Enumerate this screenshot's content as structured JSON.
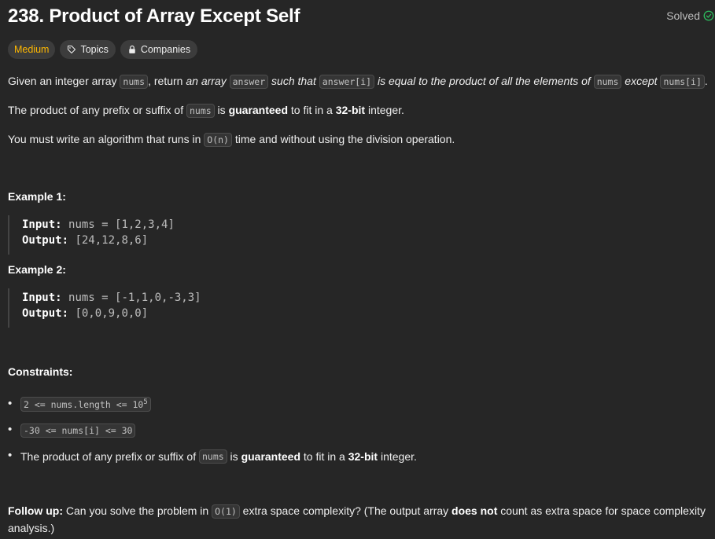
{
  "title": "238. Product of Array Except Self",
  "status": "Solved",
  "pills": {
    "difficulty": "Medium",
    "topics": "Topics",
    "companies": "Companies"
  },
  "desc": {
    "p1": {
      "t1": "Given an integer array ",
      "c1": "nums",
      "t2": ", return ",
      "e1": "an array",
      "c2": "answer",
      "e2": "such that",
      "c3": "answer[i]",
      "e3": "is equal to the product of all the elements of",
      "c4": "nums",
      "e4": "except",
      "c5": "nums[i]",
      "t3": "."
    },
    "p2": {
      "t1": "The product of any prefix or suffix of ",
      "c1": "nums",
      "t2": " is ",
      "b1": "guaranteed",
      "t3": " to fit in a ",
      "b2": "32-bit",
      "t4": " integer."
    },
    "p3": {
      "t1": "You must write an algorithm that runs in ",
      "c1": "O(n)",
      "t2": " time and without using the division operation."
    }
  },
  "examples": [
    {
      "title": "Example 1:",
      "input_label": "Input:",
      "input": "nums = [1,2,3,4]",
      "output_label": "Output:",
      "output": "[24,12,8,6]"
    },
    {
      "title": "Example 2:",
      "input_label": "Input:",
      "input": "nums = [-1,1,0,-3,3]",
      "output_label": "Output:",
      "output": "[0,0,9,0,0]"
    }
  ],
  "constraints": {
    "title": "Constraints:",
    "c1": {
      "code": "2 <= nums.length <= 10",
      "sup": "5"
    },
    "c2": {
      "code": "-30 <= nums[i] <= 30"
    },
    "c3": {
      "t1": "The product of any prefix or suffix of ",
      "code": "nums",
      "t2": " is ",
      "b1": "guaranteed",
      "t3": " to fit in a ",
      "b2": "32-bit",
      "t4": " integer."
    }
  },
  "follow": {
    "label": "Follow up:",
    "t1": " Can you solve the problem in ",
    "code": "O(1)",
    "t2": " extra space complexity? (The output array ",
    "b1": "does not",
    "t3": " count as extra space for space complexity analysis.)"
  },
  "colors": {
    "background": "#262626",
    "medium": "#ffb800",
    "solved_check": "#2cbb5d"
  },
  "icons": {
    "solved": "check-circle-icon",
    "topics": "tag-icon",
    "companies": "lock-icon"
  }
}
